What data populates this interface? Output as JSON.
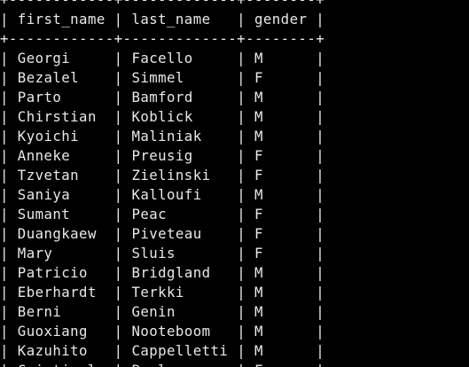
{
  "table": {
    "columns": [
      "first_name",
      "last_name",
      "gender"
    ],
    "rows": [
      [
        "Georgi",
        "Facello",
        "M"
      ],
      [
        "Bezalel",
        "Simmel",
        "F"
      ],
      [
        "Parto",
        "Bamford",
        "M"
      ],
      [
        "Chirstian",
        "Koblick",
        "M"
      ],
      [
        "Kyoichi",
        "Maliniak",
        "M"
      ],
      [
        "Anneke",
        "Preusig",
        "F"
      ],
      [
        "Tzvetan",
        "Zielinski",
        "F"
      ],
      [
        "Saniya",
        "Kalloufi",
        "M"
      ],
      [
        "Sumant",
        "Peac",
        "F"
      ],
      [
        "Duangkaew",
        "Piveteau",
        "F"
      ],
      [
        "Mary",
        "Sluis",
        "F"
      ],
      [
        "Patricio",
        "Bridgland",
        "M"
      ],
      [
        "Eberhardt",
        "Terkki",
        "M"
      ],
      [
        "Berni",
        "Genin",
        "M"
      ],
      [
        "Guoxiang",
        "Nooteboom",
        "M"
      ],
      [
        "Kazuhito",
        "Cappelletti",
        "M"
      ],
      [
        "Cristinel",
        "Bouloucos",
        "F"
      ]
    ]
  }
}
